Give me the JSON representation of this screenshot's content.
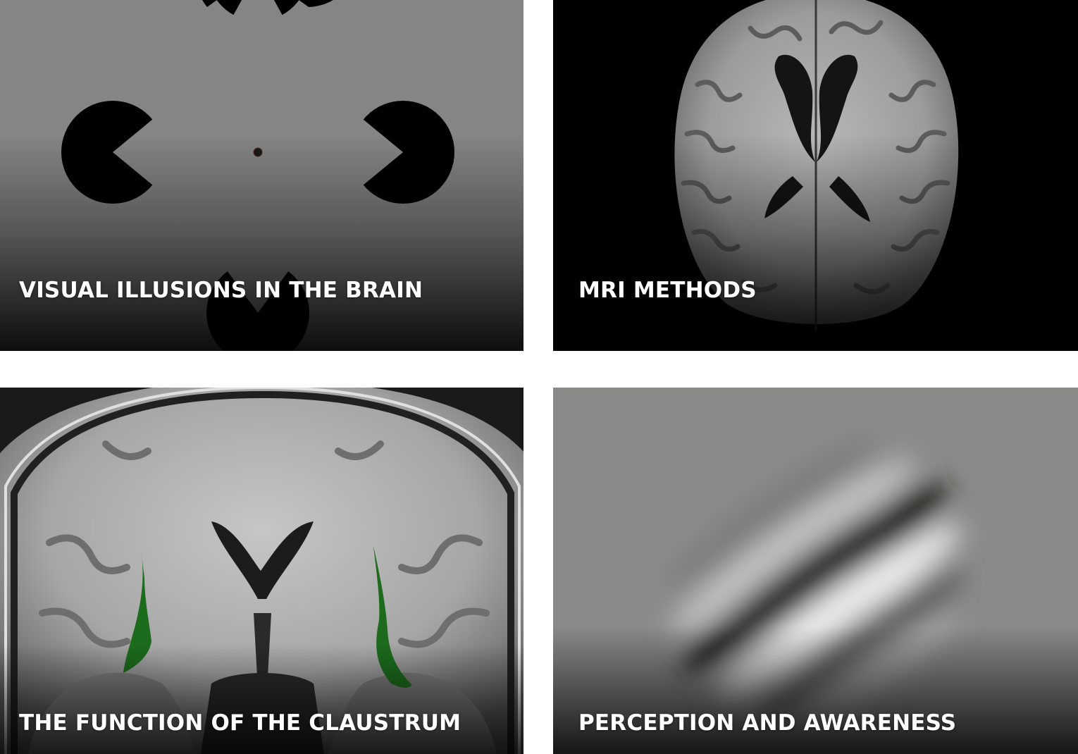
{
  "tiles": [
    {
      "title": "VISUAL ILLUSIONS IN THE BRAIN",
      "image": "kanizsa-illusion"
    },
    {
      "title": "MRI METHODS",
      "image": "axial-brain-mri"
    },
    {
      "title": "THE FUNCTION OF THE CLAUSTRUM",
      "image": "coronal-brain-mri-claustrum"
    },
    {
      "title": "PERCEPTION AND AWARENESS",
      "image": "gabor-patch"
    }
  ],
  "colors": {
    "illusion_background": "#858585",
    "pacman": "#000000",
    "mri_background": "#000000",
    "claustrum_highlight": "#1d6b1d",
    "gabor_background": "#8a8b88",
    "title_text": "#ffffff"
  }
}
